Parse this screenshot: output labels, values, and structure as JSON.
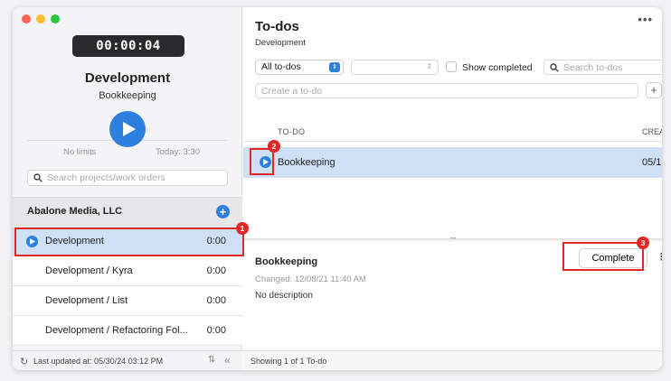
{
  "sidebar": {
    "timer": "00:00:04",
    "project_title": "Development",
    "project_subtitle": "Bookkeeping",
    "no_limits": "No limits",
    "today": "Today: 3:30",
    "search_placeholder": "Search projects/work orders",
    "client_name": "Abalone Media, LLC",
    "items": [
      {
        "label": "Development",
        "time": "0:00"
      },
      {
        "label": "Development / Kyra",
        "time": "0:00"
      },
      {
        "label": "Development / List",
        "time": "0:00"
      },
      {
        "label": "Development / Refactoring Fol...",
        "time": "0:00"
      }
    ],
    "footer_updated": "Last updated at: 05/30/24 03:12 PM"
  },
  "main": {
    "title": "To-dos",
    "subtitle": "Development",
    "filter_selected": "All to-dos",
    "show_completed_label": "Show completed",
    "search_placeholder": "Search to-dos",
    "create_placeholder": "Create a to-do",
    "columns": {
      "todo": "TO-DO",
      "created": "CREA"
    },
    "rows": [
      {
        "label": "Bookkeeping",
        "date": "05/1"
      }
    ],
    "detail": {
      "title": "Bookkeeping",
      "complete_label": "Complete",
      "changed": "Changed: 12/08/21 11:40 AM",
      "description": "No description"
    },
    "footer": "Showing 1 of 1 To-do"
  },
  "annotations": [
    "1",
    "2",
    "3"
  ],
  "colors": {
    "accent": "#2d7fe0",
    "selection": "#cfe0f6",
    "annotation": "#e52626"
  }
}
